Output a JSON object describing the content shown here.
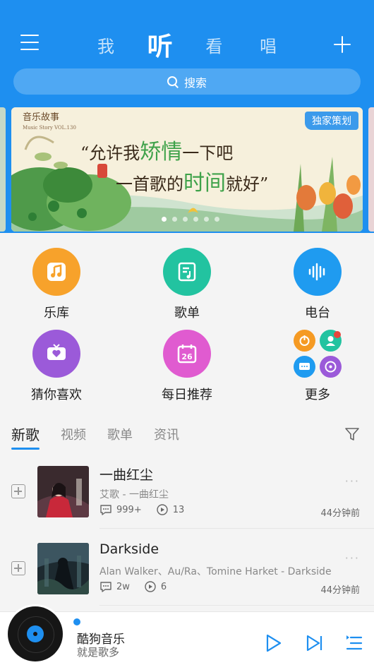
{
  "header": {
    "tabs": [
      {
        "label": "我"
      },
      {
        "label": "听"
      },
      {
        "label": "看"
      },
      {
        "label": "唱"
      }
    ],
    "active_tab": "听",
    "search_label": "搜索"
  },
  "banner": {
    "logo_text": "音乐故事",
    "logo_sub": "Music Story VOL.130",
    "badge": "独家策划",
    "line1_a": "“允许我",
    "line1_b": "矫情",
    "line1_c": "一下吧",
    "line2_a": "一首歌的",
    "line2_b": "时间",
    "line2_c": "就好”",
    "dot_count": 6,
    "active_dot": 0
  },
  "grid": {
    "items": [
      {
        "label": "乐库",
        "icon": "music-note-icon",
        "color": "#f7a22b"
      },
      {
        "label": "歌单",
        "icon": "playlist-icon",
        "color": "#22c3a0"
      },
      {
        "label": "电台",
        "icon": "soundwave-icon",
        "color": "#1f9bf0"
      },
      {
        "label": "猜你喜欢",
        "icon": "radio-heart-icon",
        "color": "#9b5ad9"
      },
      {
        "label": "每日推荐",
        "icon": "calendar-icon",
        "color": "#e05bd0"
      },
      {
        "label": "更多",
        "icon": "more-apps-icon",
        "color": "#f59a23"
      }
    ],
    "calendar_day": "26"
  },
  "section_tabs": [
    {
      "label": "新歌"
    },
    {
      "label": "视频"
    },
    {
      "label": "歌单"
    },
    {
      "label": "资讯"
    }
  ],
  "songs": [
    {
      "title": "一曲红尘",
      "subtitle": "艾歌 - 一曲红尘",
      "comments": "999+",
      "plays": "13",
      "time": "44分钟前"
    },
    {
      "title": "Darkside",
      "subtitle": "Alan Walker、Au/Ra、Tomine Harket - Darkside",
      "comments": "2w",
      "plays": "6",
      "time": "44分钟前"
    }
  ],
  "player": {
    "title": "酷狗音乐",
    "subtitle": "就是歌多"
  },
  "colors": {
    "brand": "#1e8ff0",
    "search_bg": "#4fa8f3"
  }
}
